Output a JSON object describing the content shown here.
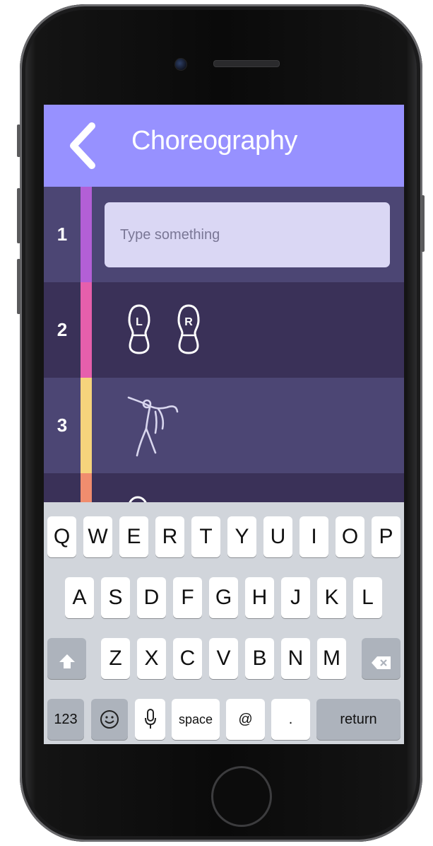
{
  "header": {
    "back_icon": "chevron-left-icon",
    "title": "Choreography"
  },
  "rows": [
    {
      "number": "1",
      "accent": "#b35fd6",
      "input_placeholder": "Type something"
    },
    {
      "number": "2",
      "accent": "#e65fac",
      "icons": [
        "left-shoe-icon",
        "right-shoe-icon"
      ],
      "shoe_labels": [
        "L",
        "R"
      ]
    },
    {
      "number": "3",
      "accent": "#f6d47c",
      "icon": "dancer-pose-icon"
    },
    {
      "number": "",
      "accent": "#f08d6e",
      "icon": "partial-shoe-icon"
    }
  ],
  "keyboard": {
    "row1": [
      "Q",
      "W",
      "E",
      "R",
      "T",
      "Y",
      "U",
      "I",
      "O",
      "P"
    ],
    "row2": [
      "A",
      "S",
      "D",
      "F",
      "G",
      "H",
      "J",
      "K",
      "L"
    ],
    "row3": [
      "Z",
      "X",
      "C",
      "V",
      "B",
      "N",
      "M"
    ],
    "shift_icon": "shift-arrow-icon",
    "delete_icon": "backspace-icon",
    "numbers_label": "123",
    "emoji_icon": "emoji-smile-icon",
    "mic_icon": "microphone-icon",
    "space_label": "space",
    "at_label": "@",
    "period_label": ".",
    "return_label": "return"
  },
  "colors": {
    "navbar": "#9791ff",
    "row_light": "#4c4674",
    "row_dark": "#3a3158",
    "input_bg": "#dad7f4",
    "keyboard_bg": "#d1d5db"
  }
}
